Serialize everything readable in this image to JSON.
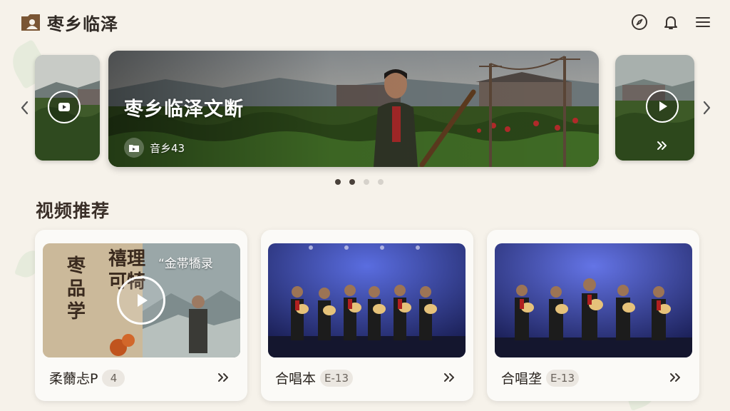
{
  "header": {
    "app_title": "枣乡临泽",
    "icons": [
      "logo-icon",
      "compass-icon",
      "bell-icon",
      "menu-icon"
    ]
  },
  "banner": {
    "title": "枣乡临泽文断",
    "meta_text": "音乡43",
    "pagination": {
      "total": 4,
      "active": 1
    }
  },
  "section": {
    "title": "视频推荐"
  },
  "cards": [
    {
      "label": "柔薾忐P",
      "badge": "4",
      "thumb_caption": "“金帯犞录",
      "calligraphy_left": "枣品学",
      "calligraphy_right": "禧理可犄"
    },
    {
      "label": "合唱本",
      "badge": "E-13"
    },
    {
      "label": "合唱垄",
      "badge": "E-13"
    }
  ],
  "colors": {
    "background": "#f6f2ea",
    "accent": "#4a423b",
    "card": "#fbfaf7"
  }
}
